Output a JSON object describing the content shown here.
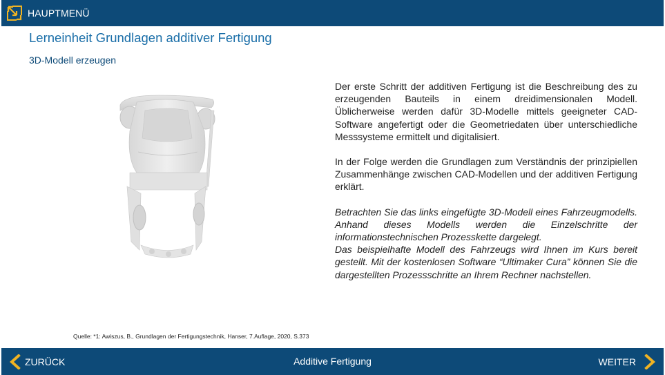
{
  "header": {
    "menu_label": "HAUPTMENÜ",
    "menu_icon": "expand-icon",
    "accent": "#f0b323"
  },
  "main": {
    "title": "Lerneinheit Grundlagen additiver Fertigung",
    "subtitle": "3D-Modell erzeugen",
    "paragraph1": "Der erste Schritt der additiven Fertigung ist die Beschreibung des zu erzeugenden Bauteils in einem dreidimensionalen Modell. Üblicherweise werden dafür 3D-Modelle mittels geeigneter CAD-Software angefertigt oder die Geometriedaten über unterschiedliche Messsysteme ermittelt und digitalisiert.",
    "paragraph2": "In der Folge werden die Grundlagen zum Verständnis der prinzipiellen Zusammenhänge zwischen CAD-Modellen und der additiven Fertigung erklärt.",
    "paragraph3": "Betrachten Sie das links eingefügte 3D-Modell eines Fahrzeugmodells. Anhand dieses Modells werden die Einzelschritte der informationstechnischen Prozesskette dargelegt.",
    "paragraph4": "Das beispielhafte Modell des Fahrzeugs wird Ihnen im Kurs bereit gestellt. Mit der kostenlosen Software “Ultimaker Cura” können Sie die dargestellten Prozessschritte an Ihrem Rechner nachstellen.",
    "source": "Quelle: *1: Awiszus, B., Grundlagen der Fertigungstechnik, Hanser, 7.Auflage, 2020, S.373"
  },
  "footer": {
    "back_label": "ZURÜCK",
    "center_title": "Additive Fertigung",
    "next_label": "WEITER",
    "bar_color": "#0d4a78"
  }
}
